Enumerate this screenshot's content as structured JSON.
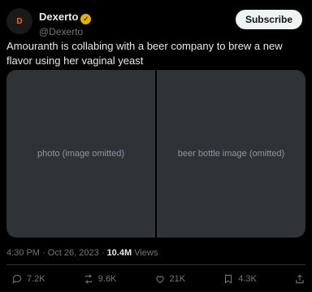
{
  "author": {
    "avatar_text": "D",
    "display_name": "Dexerto",
    "handle": "@Dexerto",
    "verified_icon": "verified-badge-icon",
    "badge_color": "#e8b100"
  },
  "subscribe_label": "Subscribe",
  "post": {
    "text": "Amouranth is collabing with a beer company to brew a new flavor using her vaginal yeast"
  },
  "media": {
    "left_alt": "photo (image omitted)",
    "right_alt": "beer bottle image (omitted)"
  },
  "meta": {
    "time": "4:30 PM",
    "sep": "·",
    "date": "Oct 26, 2023",
    "views_count": "10.4M",
    "views_label": "Views"
  },
  "actions": {
    "replies": "7.2K",
    "reposts": "9.6K",
    "likes": "21K",
    "bookmarks": "4.3K"
  },
  "colors": {
    "background": "#000000",
    "text": "#e7e9ea",
    "muted": "#71767b"
  }
}
